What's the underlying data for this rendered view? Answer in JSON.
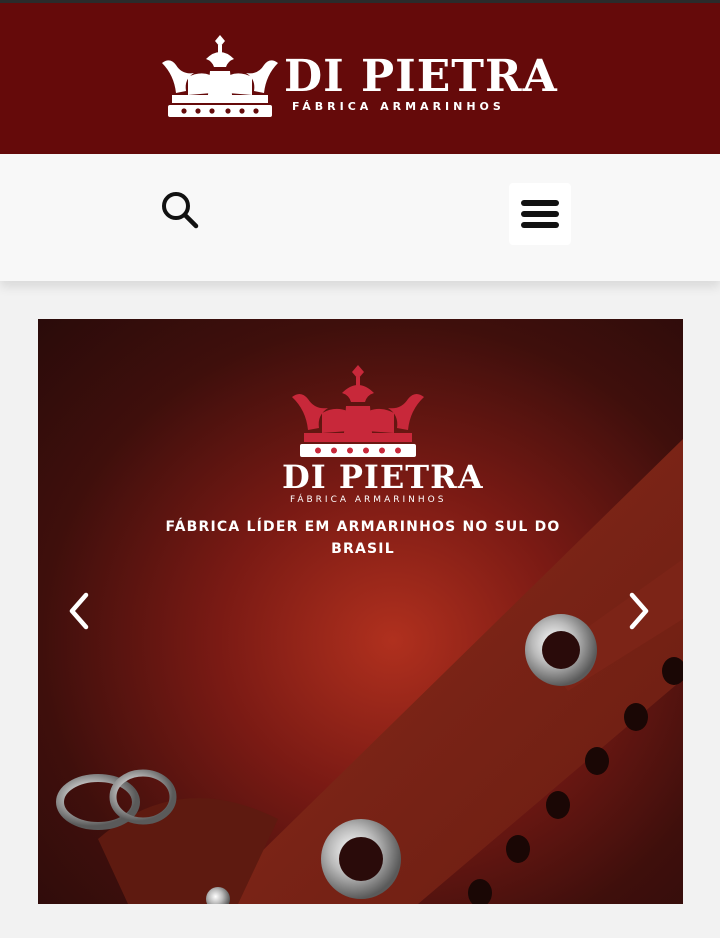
{
  "header": {
    "brand": "DI PIETRA",
    "tagline": "FÁBRICA ARMARINHOS",
    "background_color": "#650a0a"
  },
  "navbar": {
    "search_icon": "search-icon",
    "menu_icon": "hamburger-menu-icon"
  },
  "slider": {
    "brand": "DI PIETRA",
    "tagline": "FÁBRICA ARMARINHOS",
    "headline": "FÁBRICA LÍDER EM ARMARINHOS NO SUL DO BRASIL",
    "prev_icon": "chevron-left-icon",
    "next_icon": "chevron-right-icon",
    "accent_color": "#c8283a"
  }
}
